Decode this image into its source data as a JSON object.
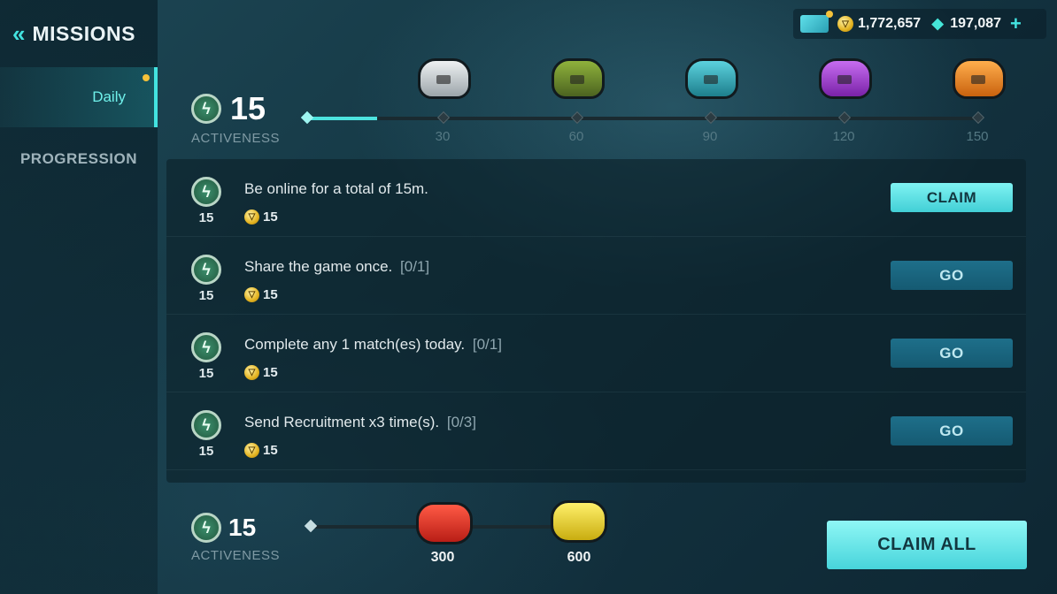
{
  "header": {
    "back_glyph": "«",
    "title": "MISSIONS"
  },
  "sidebar": {
    "items": [
      {
        "label": "Daily"
      },
      {
        "label": "PROGRESSION"
      }
    ]
  },
  "currency": {
    "coins": "1,772,657",
    "gems": "197,087",
    "plus": "+"
  },
  "activeness": {
    "value": "15",
    "label": "ACTIVENESS",
    "milestones": [
      {
        "label": "30",
        "chest": "white-chest-icon",
        "color": "#d8dde0"
      },
      {
        "label": "60",
        "chest": "green-chest-icon",
        "color": "#6f8f2c"
      },
      {
        "label": "90",
        "chest": "teal-chest-icon",
        "color": "#2aa7b6"
      },
      {
        "label": "120",
        "chest": "purple-chest-icon",
        "color": "#a23fd6"
      },
      {
        "label": "150",
        "chest": "orange-chest-icon",
        "color": "#f08a1f"
      }
    ]
  },
  "missions": [
    {
      "points": "15",
      "text": "Be online for a total of 15m.",
      "progress": "",
      "reward": "15",
      "action": "CLAIM"
    },
    {
      "points": "15",
      "text": "Share the game once.",
      "progress": "[0/1]",
      "reward": "15",
      "action": "GO"
    },
    {
      "points": "15",
      "text": "Complete any 1 match(es) today.",
      "progress": "[0/1]",
      "reward": "15",
      "action": "GO"
    },
    {
      "points": "15",
      "text": "Send Recruitment x3 time(s).",
      "progress": "[0/3]",
      "reward": "15",
      "action": "GO"
    }
  ],
  "bottom": {
    "value": "15",
    "label": "ACTIVENESS",
    "milestones": [
      {
        "label": "300",
        "chest": "red-chest-icon",
        "color": "#e33a2c"
      },
      {
        "label": "600",
        "chest": "yellow-chest-icon",
        "color": "#e8d22a"
      }
    ],
    "claim_all": "CLAIM ALL"
  },
  "colors": {
    "accent": "#43e3e0",
    "claim_button": "#5fe3e6",
    "go_button": "#1a6680"
  }
}
